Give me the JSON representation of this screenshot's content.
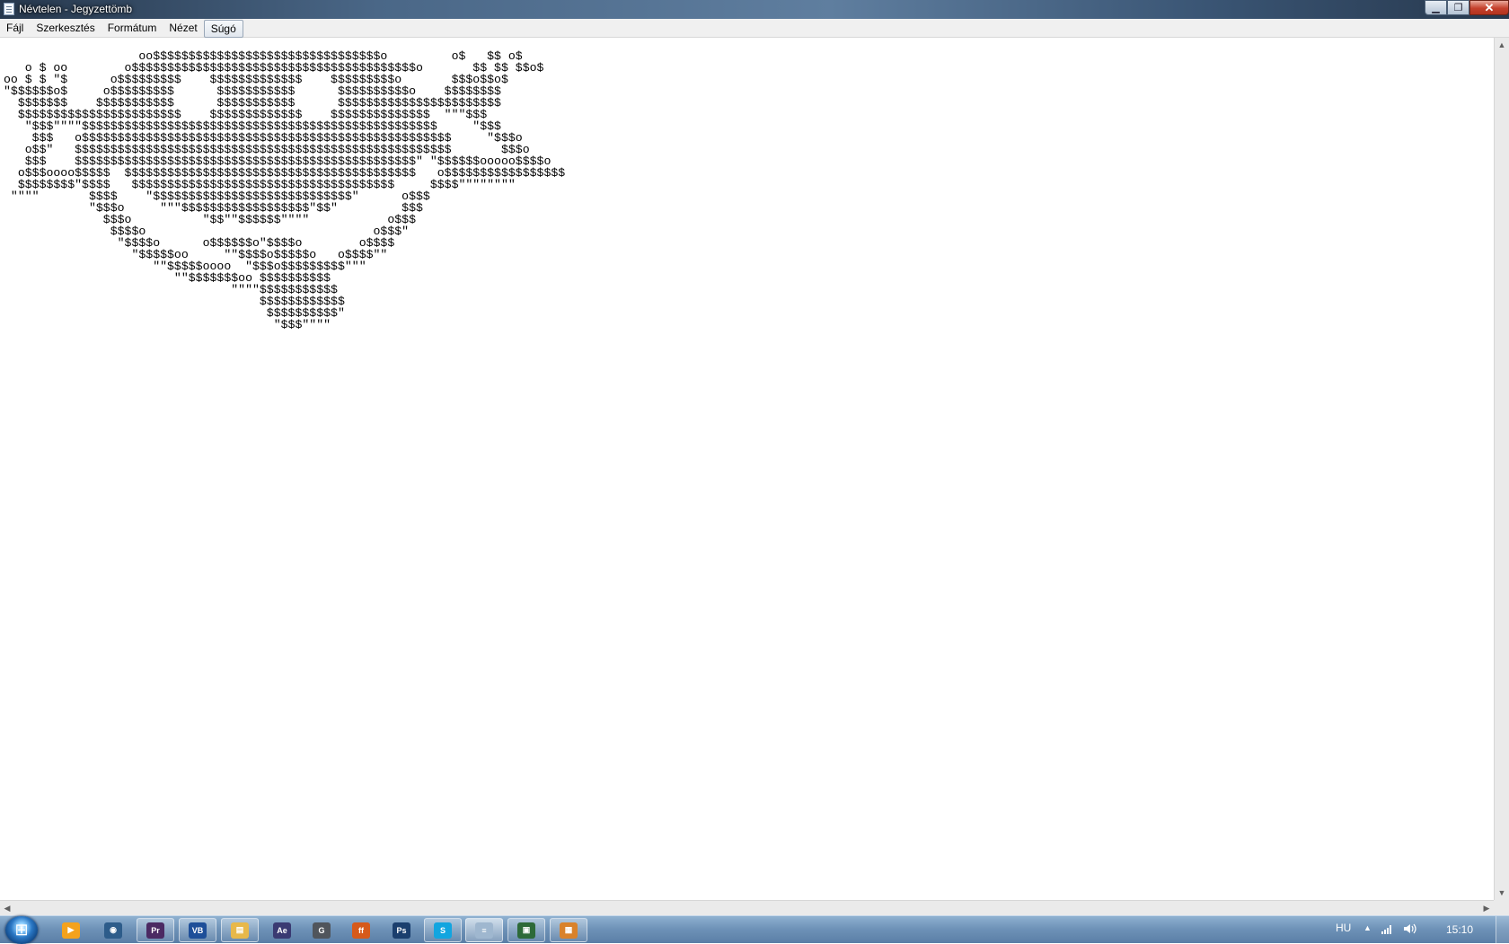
{
  "window": {
    "title": "Névtelen - Jegyzettömb",
    "controls": {
      "minimize": "▁",
      "maximize": "❐",
      "close": "✕"
    }
  },
  "menu": {
    "items": [
      "Fájl",
      "Szerkesztés",
      "Formátum",
      "Nézet",
      "Súgó"
    ],
    "active_index": 4
  },
  "editor": {
    "text": "                   oo$$$$$$$$$$$$$$$$$$$$$$$$$$$$$$$$o         o$   $$ o$\n   o $ oo        o$$$$$$$$$$$$$$$$$$$$$$$$$$$$$$$$$$$$$$$$o       $$ $$ $$o$\noo $ $ \"$      o$$$$$$$$$    $$$$$$$$$$$$$    $$$$$$$$$o       $$$o$$o$\n\"$$$$$$o$     o$$$$$$$$$      $$$$$$$$$$$      $$$$$$$$$$o    $$$$$$$$\n  $$$$$$$    $$$$$$$$$$$      $$$$$$$$$$$      $$$$$$$$$$$$$$$$$$$$$$$\n  $$$$$$$$$$$$$$$$$$$$$$$    $$$$$$$$$$$$$    $$$$$$$$$$$$$$  \"\"\"$$$\n   \"$$$\"\"\"\"$$$$$$$$$$$$$$$$$$$$$$$$$$$$$$$$$$$$$$$$$$$$$$$$$$     \"$$$\n    $$$   o$$$$$$$$$$$$$$$$$$$$$$$$$$$$$$$$$$$$$$$$$$$$$$$$$$$$     \"$$$o\n   o$$\"   $$$$$$$$$$$$$$$$$$$$$$$$$$$$$$$$$$$$$$$$$$$$$$$$$$$$$       $$$o\n   $$$    $$$$$$$$$$$$$$$$$$$$$$$$$$$$$$$$$$$$$$$$$$$$$$$$\" \"$$$$$$ooooo$$$$o\n  o$$$oooo$$$$$  $$$$$$$$$$$$$$$$$$$$$$$$$$$$$$$$$$$$$$$$$   o$$$$$$$$$$$$$$$$$\n  $$$$$$$$\"$$$$   $$$$$$$$$$$$$$$$$$$$$$$$$$$$$$$$$$$$$     $$$$\"\"\"\"\"\"\"\"\n \"\"\"\"       $$$$    \"$$$$$$$$$$$$$$$$$$$$$$$$$$$$\"      o$$$\n            \"$$$o     \"\"\"$$$$$$$$$$$$$$$$$$\"$$\"         $$$\n              $$$o          \"$$\"\"$$$$$$\"\"\"\"           o$$$\n               $$$$o                                o$$$\"\n                \"$$$$o      o$$$$$$o\"$$$$o        o$$$$\n                  \"$$$$$oo     \"\"$$$$o$$$$$o   o$$$$\"\"\n                     \"\"$$$$$oooo  \"$$$o$$$$$$$$$\"\"\"\n                        \"\"$$$$$$$oo $$$$$$$$$$\n                                \"\"\"\"$$$$$$$$$$$\n                                    $$$$$$$$$$$$\n                                     $$$$$$$$$$\"\n                                      \"$$$\"\"\"\""
  },
  "taskbar": {
    "apps": [
      {
        "name": "media-player",
        "label": "▶",
        "color": "#f4a21d"
      },
      {
        "name": "browser-globe",
        "label": "◉",
        "color": "#2d5c8a"
      },
      {
        "name": "premiere",
        "label": "Pr",
        "color": "#4b2a63"
      },
      {
        "name": "virtualbox",
        "label": "VB",
        "color": "#1e4f99"
      },
      {
        "name": "file-explorer",
        "label": "▤",
        "color": "#e8b84a"
      },
      {
        "name": "after-effects",
        "label": "Ae",
        "color": "#3a3a72"
      },
      {
        "name": "chrome-like",
        "label": "G",
        "color": "#50555c"
      },
      {
        "name": "firefox",
        "label": "ff",
        "color": "#d65a1a"
      },
      {
        "name": "photoshop",
        "label": "Ps",
        "color": "#1b3f6e"
      },
      {
        "name": "skype",
        "label": "S",
        "color": "#12a5e0"
      },
      {
        "name": "notepad",
        "label": "≡",
        "color": "#9fb7cf"
      },
      {
        "name": "terminal",
        "label": "▣",
        "color": "#2d6a39"
      },
      {
        "name": "paint",
        "label": "▦",
        "color": "#d9822b"
      }
    ],
    "active_index": 10,
    "tray": {
      "language": "HU",
      "time": "15:10"
    }
  }
}
